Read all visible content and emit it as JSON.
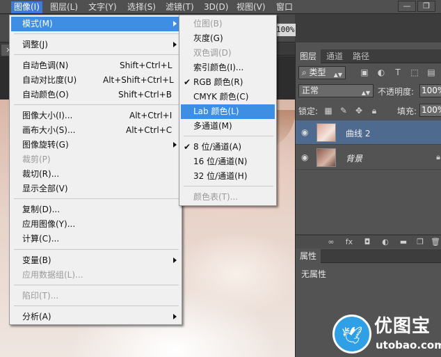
{
  "menubar": {
    "items": [
      "图像(I)",
      "图层(L)",
      "文字(Y)",
      "选择(S)",
      "滤镜(T)",
      "3D(D)",
      "视图(V)",
      "窗口"
    ],
    "window_buttons": [
      "—",
      "❐"
    ]
  },
  "options_bar": {
    "zoom": "100%"
  },
  "image_menu": {
    "items": [
      {
        "label": "模式(M)",
        "submenu": true
      },
      {
        "label": "调整(J)",
        "submenu": true
      },
      {
        "label": "自动色调(N)",
        "shortcut": "Shift+Ctrl+L"
      },
      {
        "label": "自动对比度(U)",
        "shortcut": "Alt+Shift+Ctrl+L"
      },
      {
        "label": "自动颜色(O)",
        "shortcut": "Shift+Ctrl+B"
      },
      {
        "label": "图像大小(I)...",
        "shortcut": "Alt+Ctrl+I"
      },
      {
        "label": "画布大小(S)...",
        "shortcut": "Alt+Ctrl+C"
      },
      {
        "label": "图像旋转(G)",
        "submenu": true
      },
      {
        "label": "裁剪(P)",
        "disabled": true
      },
      {
        "label": "裁切(R)..."
      },
      {
        "label": "显示全部(V)"
      },
      {
        "label": "复制(D)..."
      },
      {
        "label": "应用图像(Y)..."
      },
      {
        "label": "计算(C)..."
      },
      {
        "label": "变量(B)",
        "submenu": true
      },
      {
        "label": "应用数据组(L)...",
        "disabled": true
      },
      {
        "label": "陷印(T)...",
        "disabled": true
      },
      {
        "label": "分析(A)",
        "submenu": true
      }
    ]
  },
  "mode_submenu": {
    "items": [
      {
        "label": "位图(B)",
        "disabled": true
      },
      {
        "label": "灰度(G)"
      },
      {
        "label": "双色调(D)",
        "disabled": true
      },
      {
        "label": "索引颜色(I)..."
      },
      {
        "label": "RGB 颜色(R)",
        "checked": true
      },
      {
        "label": "CMYK 颜色(C)"
      },
      {
        "label": "Lab 颜色(L)",
        "highlighted": true
      },
      {
        "label": "多通道(M)"
      },
      {
        "label": "8 位/通道(A)",
        "checked": true
      },
      {
        "label": "16 位/通道(N)"
      },
      {
        "label": "32 位/通道(H)"
      },
      {
        "label": "颜色表(T)...",
        "disabled": true
      }
    ]
  },
  "layers_panel": {
    "tabs": [
      "图层",
      "通道",
      "路径"
    ],
    "filter_kind": "类型",
    "blend_mode": "正常",
    "opacity_label": "不透明度:",
    "opacity_value": "100%",
    "lock_label": "锁定:",
    "fill_label": "填充:",
    "fill_value": "100%",
    "layers": [
      {
        "name": "曲线 2",
        "selected": true
      },
      {
        "name": "背景",
        "italic": true,
        "locked": true
      }
    ]
  },
  "properties_panel": {
    "tab": "属性",
    "empty_text": "无属性"
  },
  "watermark": {
    "cn": "优图宝",
    "en": "utobao.com"
  },
  "colors": {
    "menu_highlight": "#3e8ee3",
    "panel_bg": "#535353",
    "selected_layer": "#4e6b8f"
  }
}
